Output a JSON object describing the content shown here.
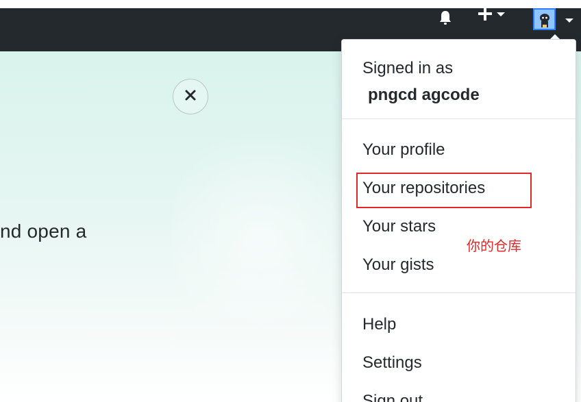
{
  "header": {
    "icons": {
      "bell": "bell-icon",
      "plus": "plus-icon",
      "caret": "caret-down-icon",
      "avatar": "octocat-avatar"
    },
    "colors": {
      "header_bg": "#24292e",
      "accent": "#2f81f7"
    }
  },
  "hero": {
    "text": "nd open a",
    "close_icon": "close-icon"
  },
  "dropdown": {
    "signed_in_label": "Signed in as",
    "username": "pngcd agcode",
    "items_group1": [
      {
        "label": "Your profile"
      },
      {
        "label": "Your repositories"
      },
      {
        "label": "Your stars"
      },
      {
        "label": "Your gists"
      }
    ],
    "items_group2": [
      {
        "label": "Help"
      },
      {
        "label": "Settings"
      },
      {
        "label": "Sign out"
      }
    ]
  },
  "annotation": {
    "text": "你的仓库",
    "color": "#e0282a"
  }
}
